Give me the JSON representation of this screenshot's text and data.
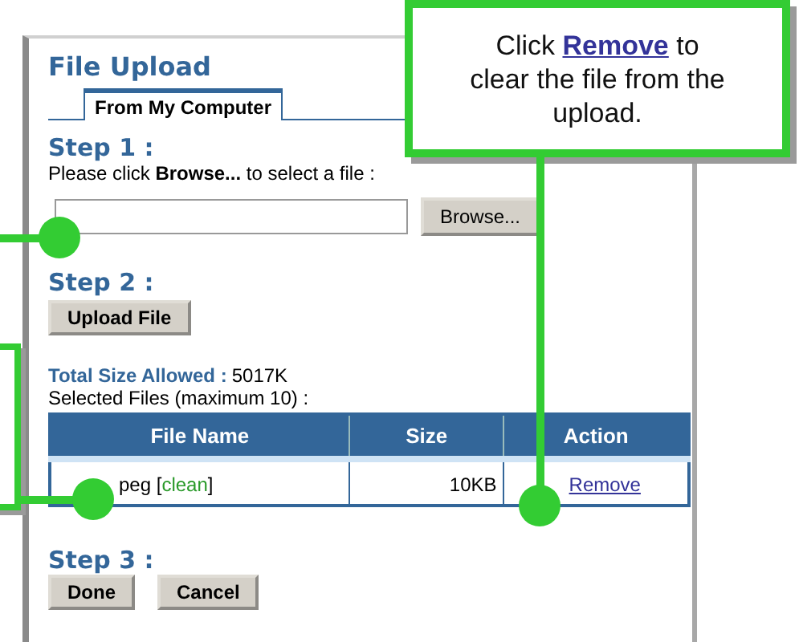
{
  "panel": {
    "title": "File Upload",
    "tabs": [
      {
        "label": "From My Computer",
        "selected": true
      }
    ],
    "step1": {
      "heading": "Step 1 :",
      "instruction": "Please click **Browse...** to select a file :",
      "browse_button": "Browse..."
    },
    "step2": {
      "heading": "Step 2 :",
      "upload_button": "Upload File"
    },
    "total_size": {
      "label": "Total Size Allowed :",
      "value": "5017K"
    },
    "selected_files_label": "Selected Files (maximum 10) :",
    "table": {
      "columns": [
        "File Name",
        "Size",
        "Action"
      ],
      "rows": [
        {
          "file_name": "peg [",
          "status": "clean",
          "status_end": "]",
          "size": "10KB",
          "action": "Remove"
        }
      ]
    },
    "step3": {
      "heading": "Step 3 :",
      "buttons": [
        "Done",
        "Cancel"
      ]
    }
  },
  "callout": {
    "text": "Click **Remove** to clear the file from the upload."
  }
}
